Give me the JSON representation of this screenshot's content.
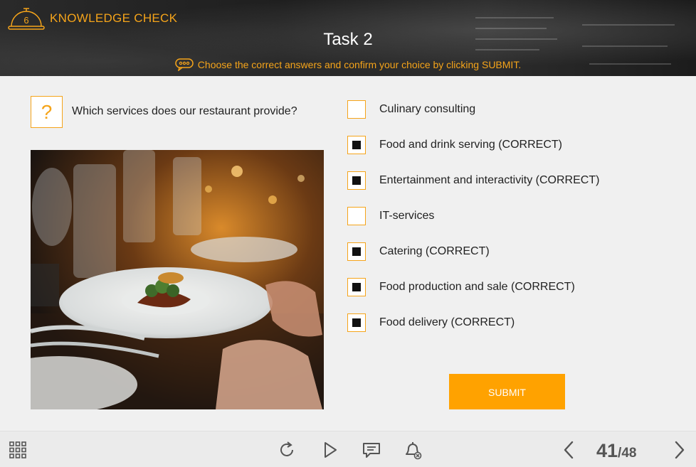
{
  "header": {
    "badge_number": "6",
    "knowledge_check": "KNOWLEDGE CHECK",
    "task_title": "Task 2",
    "instruction": "Choose the correct answers and confirm your choice by clicking SUBMIT."
  },
  "question": {
    "icon": "?",
    "text": "Which services does our restaurant provide?"
  },
  "options": [
    {
      "label": "Culinary consulting",
      "checked": false
    },
    {
      "label": "Food and drink serving (CORRECT)",
      "checked": true
    },
    {
      "label": "Entertainment and interactivity (CORRECT)",
      "checked": true
    },
    {
      "label": "IT-services",
      "checked": false
    },
    {
      "label": "Catering (CORRECT)",
      "checked": true
    },
    {
      "label": "Food production and sale (CORRECT)",
      "checked": true
    },
    {
      "label": "Food delivery (CORRECT)",
      "checked": true
    }
  ],
  "submit_label": "SUBMIT",
  "footer": {
    "page_current": "41",
    "page_total": "/48",
    "icons": [
      "grid-menu-icon",
      "replay-icon",
      "play-icon",
      "comment-icon",
      "notifications-off-icon",
      "chevron-left-icon",
      "chevron-right-icon"
    ]
  },
  "colors": {
    "accent": "#f5a41a",
    "submit": "#ffa200",
    "checked_fill": "#111111"
  }
}
